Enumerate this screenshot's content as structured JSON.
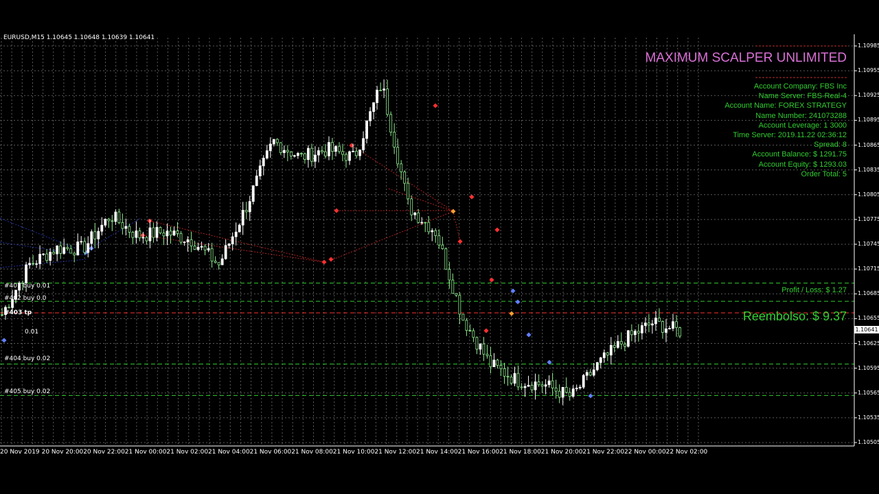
{
  "symbol_header": "EURUSD,M15  1.10645 1.10648 1.10639 1.10641",
  "ea": {
    "title": "MAXIMUM SCALPER UNLIMITED",
    "info": [
      "Account Company: FBS Inc",
      "Name Server: FBS-Real-4",
      "Account Name: FOREX STRATEGY",
      "Name Number: 241073288",
      "Account Leverage: 1 3000",
      "Time Server: 2019.11.22 02:36:12",
      "Spread: 8",
      "Account Balance: $ 1291.75",
      "Account Equity: $ 1293.03",
      "Order Total: 5"
    ],
    "profit_loss": "Profit / Loss: $ 1.27",
    "reembolso": "Reembolso: $ 9.37"
  },
  "orders": [
    {
      "label": "#401 buy 0.01",
      "price": 1.10698
    },
    {
      "label": "#402 buy 0.0",
      "price": 1.10676
    },
    {
      "label": "#403 tp",
      "price": 1.10662
    },
    {
      "label": "#404 buy 0.02",
      "price": 1.106
    },
    {
      "label": "#405 buy 0.02",
      "price": 1.10562
    }
  ],
  "order_403_extra": "0.01",
  "current_price": "1.10641",
  "colors": {
    "background": "#000000",
    "grid": "#5a5a5a",
    "bull_candle": "#ffffff",
    "bear_candle": "#90ee90",
    "title": "#da70d6",
    "info": "#32cd32",
    "order_line": "#32cd32",
    "tp_line": "#ff3030"
  },
  "chart_data": {
    "type": "candlestick",
    "symbol": "EURUSD",
    "timeframe": "M15",
    "ylim": [
      1.10505,
      1.10985
    ],
    "price_ticks": [
      "1.10985",
      "1.10955",
      "1.10925",
      "1.10895",
      "1.10865",
      "1.10835",
      "1.10805",
      "1.10775",
      "1.10745",
      "1.10715",
      "1.10685",
      "1.10655",
      "1.10625",
      "1.10595",
      "1.10565",
      "1.10535",
      "1.10505"
    ],
    "time_ticks": [
      "20 Nov 2019",
      "20 Nov 20:00",
      "20 Nov 22:00",
      "21 Nov 00:00",
      "21 Nov 02:00",
      "21 Nov 04:00",
      "21 Nov 06:00",
      "21 Nov 08:00",
      "21 Nov 10:00",
      "21 Nov 12:00",
      "21 Nov 14:00",
      "21 Nov 16:00",
      "21 Nov 18:00",
      "21 Nov 20:00",
      "21 Nov 22:00",
      "22 Nov 00:00",
      "22 Nov 02:00"
    ],
    "close_path": [
      1.1066,
      1.1072,
      1.1074,
      1.1074,
      1.1078,
      1.10755,
      1.1076,
      1.1075,
      1.1072,
      1.1079,
      1.1087,
      1.1085,
      1.1086,
      1.1085,
      1.1094,
      1.1079,
      1.1076,
      1.10655,
      1.106,
      1.1058,
      1.10575,
      1.1056,
      1.106,
      1.1063,
      1.1065,
      1.1064
    ],
    "grid": true
  }
}
